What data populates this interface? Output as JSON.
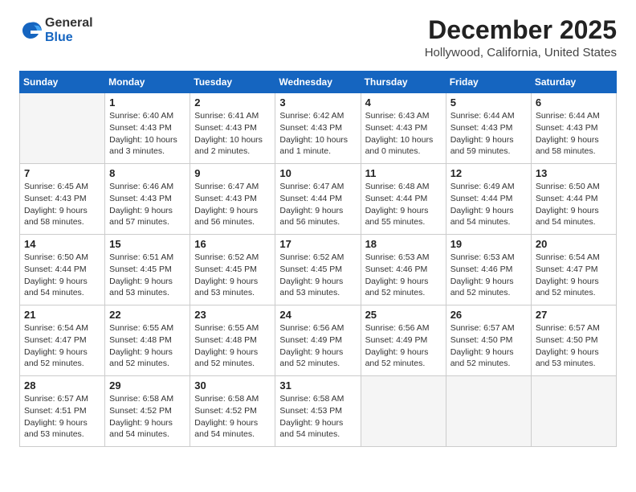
{
  "logo": {
    "general": "General",
    "blue": "Blue"
  },
  "title": "December 2025",
  "subtitle": "Hollywood, California, United States",
  "days_of_week": [
    "Sunday",
    "Monday",
    "Tuesday",
    "Wednesday",
    "Thursday",
    "Friday",
    "Saturday"
  ],
  "weeks": [
    [
      {
        "day": "",
        "info": ""
      },
      {
        "day": "1",
        "info": "Sunrise: 6:40 AM\nSunset: 4:43 PM\nDaylight: 10 hours\nand 3 minutes."
      },
      {
        "day": "2",
        "info": "Sunrise: 6:41 AM\nSunset: 4:43 PM\nDaylight: 10 hours\nand 2 minutes."
      },
      {
        "day": "3",
        "info": "Sunrise: 6:42 AM\nSunset: 4:43 PM\nDaylight: 10 hours\nand 1 minute."
      },
      {
        "day": "4",
        "info": "Sunrise: 6:43 AM\nSunset: 4:43 PM\nDaylight: 10 hours\nand 0 minutes."
      },
      {
        "day": "5",
        "info": "Sunrise: 6:44 AM\nSunset: 4:43 PM\nDaylight: 9 hours\nand 59 minutes."
      },
      {
        "day": "6",
        "info": "Sunrise: 6:44 AM\nSunset: 4:43 PM\nDaylight: 9 hours\nand 58 minutes."
      }
    ],
    [
      {
        "day": "7",
        "info": "Sunrise: 6:45 AM\nSunset: 4:43 PM\nDaylight: 9 hours\nand 58 minutes."
      },
      {
        "day": "8",
        "info": "Sunrise: 6:46 AM\nSunset: 4:43 PM\nDaylight: 9 hours\nand 57 minutes."
      },
      {
        "day": "9",
        "info": "Sunrise: 6:47 AM\nSunset: 4:43 PM\nDaylight: 9 hours\nand 56 minutes."
      },
      {
        "day": "10",
        "info": "Sunrise: 6:47 AM\nSunset: 4:44 PM\nDaylight: 9 hours\nand 56 minutes."
      },
      {
        "day": "11",
        "info": "Sunrise: 6:48 AM\nSunset: 4:44 PM\nDaylight: 9 hours\nand 55 minutes."
      },
      {
        "day": "12",
        "info": "Sunrise: 6:49 AM\nSunset: 4:44 PM\nDaylight: 9 hours\nand 54 minutes."
      },
      {
        "day": "13",
        "info": "Sunrise: 6:50 AM\nSunset: 4:44 PM\nDaylight: 9 hours\nand 54 minutes."
      }
    ],
    [
      {
        "day": "14",
        "info": "Sunrise: 6:50 AM\nSunset: 4:44 PM\nDaylight: 9 hours\nand 54 minutes."
      },
      {
        "day": "15",
        "info": "Sunrise: 6:51 AM\nSunset: 4:45 PM\nDaylight: 9 hours\nand 53 minutes."
      },
      {
        "day": "16",
        "info": "Sunrise: 6:52 AM\nSunset: 4:45 PM\nDaylight: 9 hours\nand 53 minutes."
      },
      {
        "day": "17",
        "info": "Sunrise: 6:52 AM\nSunset: 4:45 PM\nDaylight: 9 hours\nand 53 minutes."
      },
      {
        "day": "18",
        "info": "Sunrise: 6:53 AM\nSunset: 4:46 PM\nDaylight: 9 hours\nand 52 minutes."
      },
      {
        "day": "19",
        "info": "Sunrise: 6:53 AM\nSunset: 4:46 PM\nDaylight: 9 hours\nand 52 minutes."
      },
      {
        "day": "20",
        "info": "Sunrise: 6:54 AM\nSunset: 4:47 PM\nDaylight: 9 hours\nand 52 minutes."
      }
    ],
    [
      {
        "day": "21",
        "info": "Sunrise: 6:54 AM\nSunset: 4:47 PM\nDaylight: 9 hours\nand 52 minutes."
      },
      {
        "day": "22",
        "info": "Sunrise: 6:55 AM\nSunset: 4:48 PM\nDaylight: 9 hours\nand 52 minutes."
      },
      {
        "day": "23",
        "info": "Sunrise: 6:55 AM\nSunset: 4:48 PM\nDaylight: 9 hours\nand 52 minutes."
      },
      {
        "day": "24",
        "info": "Sunrise: 6:56 AM\nSunset: 4:49 PM\nDaylight: 9 hours\nand 52 minutes."
      },
      {
        "day": "25",
        "info": "Sunrise: 6:56 AM\nSunset: 4:49 PM\nDaylight: 9 hours\nand 52 minutes."
      },
      {
        "day": "26",
        "info": "Sunrise: 6:57 AM\nSunset: 4:50 PM\nDaylight: 9 hours\nand 52 minutes."
      },
      {
        "day": "27",
        "info": "Sunrise: 6:57 AM\nSunset: 4:50 PM\nDaylight: 9 hours\nand 53 minutes."
      }
    ],
    [
      {
        "day": "28",
        "info": "Sunrise: 6:57 AM\nSunset: 4:51 PM\nDaylight: 9 hours\nand 53 minutes."
      },
      {
        "day": "29",
        "info": "Sunrise: 6:58 AM\nSunset: 4:52 PM\nDaylight: 9 hours\nand 54 minutes."
      },
      {
        "day": "30",
        "info": "Sunrise: 6:58 AM\nSunset: 4:52 PM\nDaylight: 9 hours\nand 54 minutes."
      },
      {
        "day": "31",
        "info": "Sunrise: 6:58 AM\nSunset: 4:53 PM\nDaylight: 9 hours\nand 54 minutes."
      },
      {
        "day": "",
        "info": ""
      },
      {
        "day": "",
        "info": ""
      },
      {
        "day": "",
        "info": ""
      }
    ]
  ]
}
